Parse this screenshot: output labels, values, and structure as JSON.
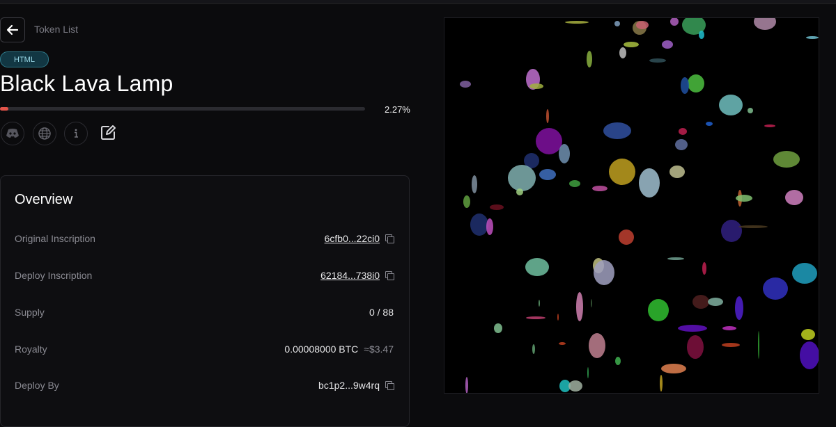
{
  "nav": {
    "breadcrumb": "Token List"
  },
  "token": {
    "type_tag": "HTML",
    "name": "Black Lava Lamp",
    "progress": 2.27,
    "progress_label": "2.27%"
  },
  "links": [
    {
      "icon": "discord-icon"
    },
    {
      "icon": "globe-icon"
    },
    {
      "icon": "info-icon"
    },
    {
      "icon": "edit-icon"
    }
  ],
  "overview": {
    "title": "Overview",
    "rows": [
      {
        "label": "Original Inscription",
        "value": "6cfb0...22ci0",
        "copy": true
      },
      {
        "label": "Deploy Inscription",
        "value": "62184...738i0",
        "copy": true
      },
      {
        "label": "Supply",
        "value": "0 / 88"
      },
      {
        "label": "Royalty",
        "value": "0.00008000 BTC",
        "extra": "≈$3.47"
      },
      {
        "label": "Deploy By",
        "value": "bc1p2...9w4rq",
        "copy": true
      }
    ]
  },
  "colors": {
    "accent": "#e2544a",
    "tag_bg": "#123743",
    "background": "#0b0b0d"
  }
}
